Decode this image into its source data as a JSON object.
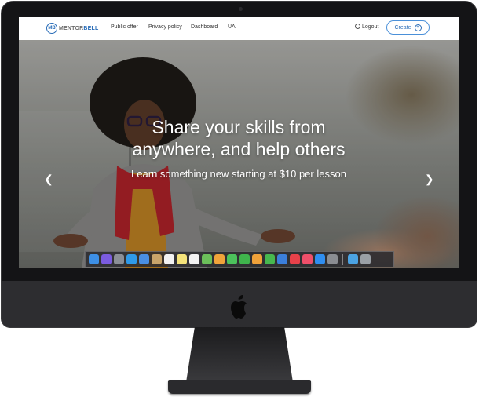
{
  "nav": {
    "logo_mark": "MB",
    "logo_text_a": "MENTOR",
    "logo_text_b": "BELL",
    "links": [
      "Public offer",
      "Privacy policy",
      "Dashboard",
      "UA"
    ],
    "logout_label": "Logout",
    "create_label": "Create"
  },
  "hero": {
    "headline_line1": "Share your skills from",
    "headline_line2": "anywhere, and help others",
    "subline": "Learn something new starting at $10 per lesson"
  },
  "dock": {
    "icons": [
      {
        "name": "finder-icon",
        "color": "#3d8fe6"
      },
      {
        "name": "siri-icon",
        "color": "#7b5ce0"
      },
      {
        "name": "launchpad-icon",
        "color": "#8b8f96"
      },
      {
        "name": "safari-icon",
        "color": "#2f9ae8"
      },
      {
        "name": "mail-icon",
        "color": "#4a8fe2"
      },
      {
        "name": "contacts-icon",
        "color": "#c8a46a"
      },
      {
        "name": "calendar-icon",
        "color": "#f2f2f2"
      },
      {
        "name": "notes-icon",
        "color": "#f4e27a"
      },
      {
        "name": "reminders-icon",
        "color": "#f3f3f3"
      },
      {
        "name": "maps-icon",
        "color": "#6cbf5a"
      },
      {
        "name": "photos-icon",
        "color": "#f0a33a"
      },
      {
        "name": "messages-icon",
        "color": "#4cc25c"
      },
      {
        "name": "facetime-icon",
        "color": "#3fb44c"
      },
      {
        "name": "pages-icon",
        "color": "#f0a23a"
      },
      {
        "name": "numbers-icon",
        "color": "#47b84f"
      },
      {
        "name": "keynote-icon",
        "color": "#3b7fdb"
      },
      {
        "name": "news-icon",
        "color": "#e8414a"
      },
      {
        "name": "music-icon",
        "color": "#ef4f6a"
      },
      {
        "name": "appstore-icon",
        "color": "#2f8ef0"
      },
      {
        "name": "settings-icon",
        "color": "#8a8d92"
      },
      {
        "name": "downloads-folder-icon",
        "color": "#4ba3e3"
      },
      {
        "name": "trash-icon",
        "color": "#9aa0a6"
      }
    ]
  }
}
